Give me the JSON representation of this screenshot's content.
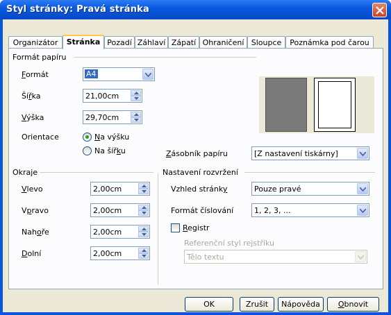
{
  "window": {
    "title": "Styl stránky: Pravá stránka"
  },
  "tabs": [
    {
      "label": "Organizátor"
    },
    {
      "label": "Stránka"
    },
    {
      "label": "Pozadí"
    },
    {
      "label": "Záhlaví"
    },
    {
      "label": "Zápatí"
    },
    {
      "label": "Ohraničení"
    },
    {
      "label": "Sloupce"
    },
    {
      "label": "Poznámka pod čarou"
    }
  ],
  "paper": {
    "group": "Formát papíru",
    "format_label_u": "F",
    "format_label_rest": "ormát",
    "format_value": "A4",
    "width_label_pre": "Ší",
    "width_label_u": "ř",
    "width_label_rest": "ka",
    "width_value": "21,00cm",
    "height_label_u": "V",
    "height_label_rest": "ýška",
    "height_value": "29,70cm",
    "orientation_label": "Orientace",
    "portrait_u": "N",
    "portrait_rest": "a výšku",
    "landscape_pre": "Na šíř",
    "landscape_u": "k",
    "landscape_rest": "u",
    "tray_u": "Z",
    "tray_rest": "ásobník papíru",
    "tray_value": "[Z nastavení tiskárny]"
  },
  "margins": {
    "group": "Okraje",
    "left_u": "V",
    "left_rest": "levo",
    "left_value": "2,00cm",
    "right_pre": "V",
    "right_u": "p",
    "right_rest": "ravo",
    "right_value": "2,00cm",
    "top_pre": "Nah",
    "top_u": "o",
    "top_rest": "ře",
    "top_value": "2,00cm",
    "bottom_u": "D",
    "bottom_rest": "olní",
    "bottom_value": "2,00cm"
  },
  "layout": {
    "group": "Nastavení rozvržení",
    "appearance_pre": "Vzhled stránk",
    "appearance_u": "y",
    "appearance_value": "Pouze pravé",
    "numbering_label": "Formát číslování",
    "numbering_value": "1, 2, 3, ...",
    "register_u": "R",
    "register_rest": "egistr",
    "refstyle_label": "Referenční styl rejstříku",
    "refstyle_value": "Tělo textu"
  },
  "buttons": {
    "ok": "OK",
    "cancel": "Zrušit",
    "help": "Nápověda",
    "reset_u": "O",
    "reset_rest": "bnovit"
  }
}
